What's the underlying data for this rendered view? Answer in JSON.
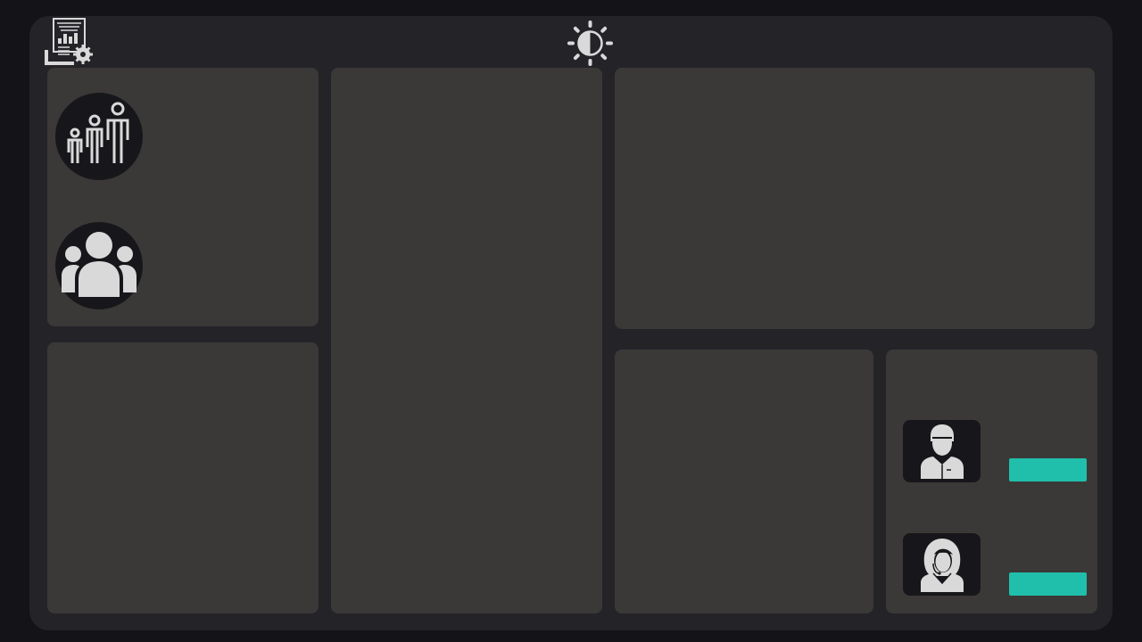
{
  "header": {
    "left_icon": "report-settings-icon",
    "center_icon": "brightness-contrast-icon"
  },
  "left_panel": {
    "icons": [
      "family-icon",
      "group-icon"
    ]
  },
  "contacts": {
    "items": [
      {
        "icon": "male-agent-icon",
        "action_label": ""
      },
      {
        "icon": "female-agent-icon",
        "action_label": ""
      }
    ]
  },
  "colors": {
    "page_bg": "#131318",
    "frame_bg": "#242328",
    "panel_bg": "#3a3937",
    "icon_bg": "#17171b",
    "icon_fg": "#d9d9d9",
    "accent": "#1fbfab"
  }
}
